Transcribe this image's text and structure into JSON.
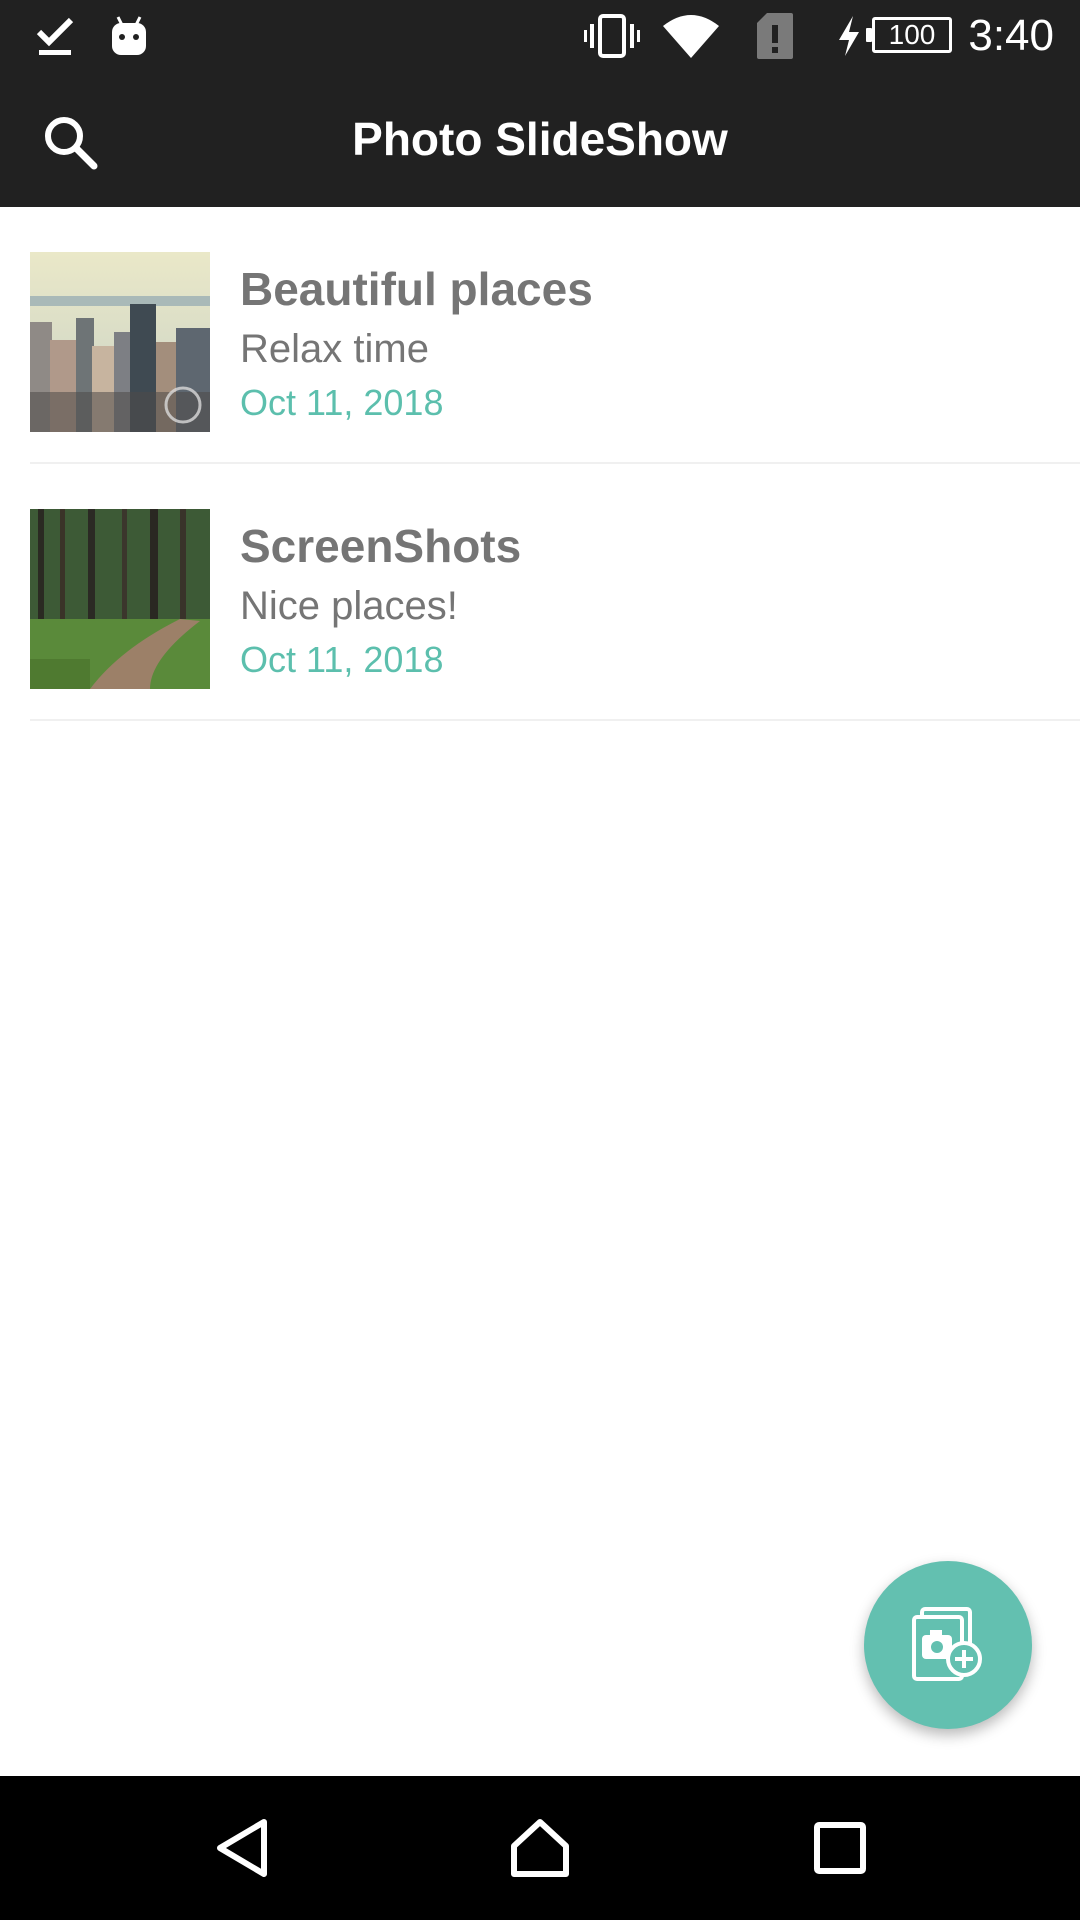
{
  "status_bar": {
    "battery": "100",
    "time": "3:40",
    "icons": [
      "download-done-icon",
      "android-icon",
      "vibrate-icon",
      "wifi-icon",
      "sim-alert-icon",
      "charging-icon",
      "battery-icon"
    ]
  },
  "app_bar": {
    "title": "Photo SlideShow",
    "search_icon": "search-icon"
  },
  "slideshows": [
    {
      "title": "Beautiful places",
      "subtitle": "Relax time",
      "date": "Oct 11, 2018",
      "thumbnail": "city-skyline-photo"
    },
    {
      "title": "ScreenShots",
      "subtitle": "Nice places!",
      "date": "Oct 11, 2018",
      "thumbnail": "forest-path-photo"
    }
  ],
  "fab": {
    "icon": "add-photo-icon"
  },
  "nav_bar": {
    "icons": [
      "back-icon",
      "home-icon",
      "recents-icon"
    ]
  },
  "colors": {
    "app_bar": "#212121",
    "accent": "#5cbfad",
    "fab": "#63c0b0",
    "text_secondary": "#757575"
  }
}
